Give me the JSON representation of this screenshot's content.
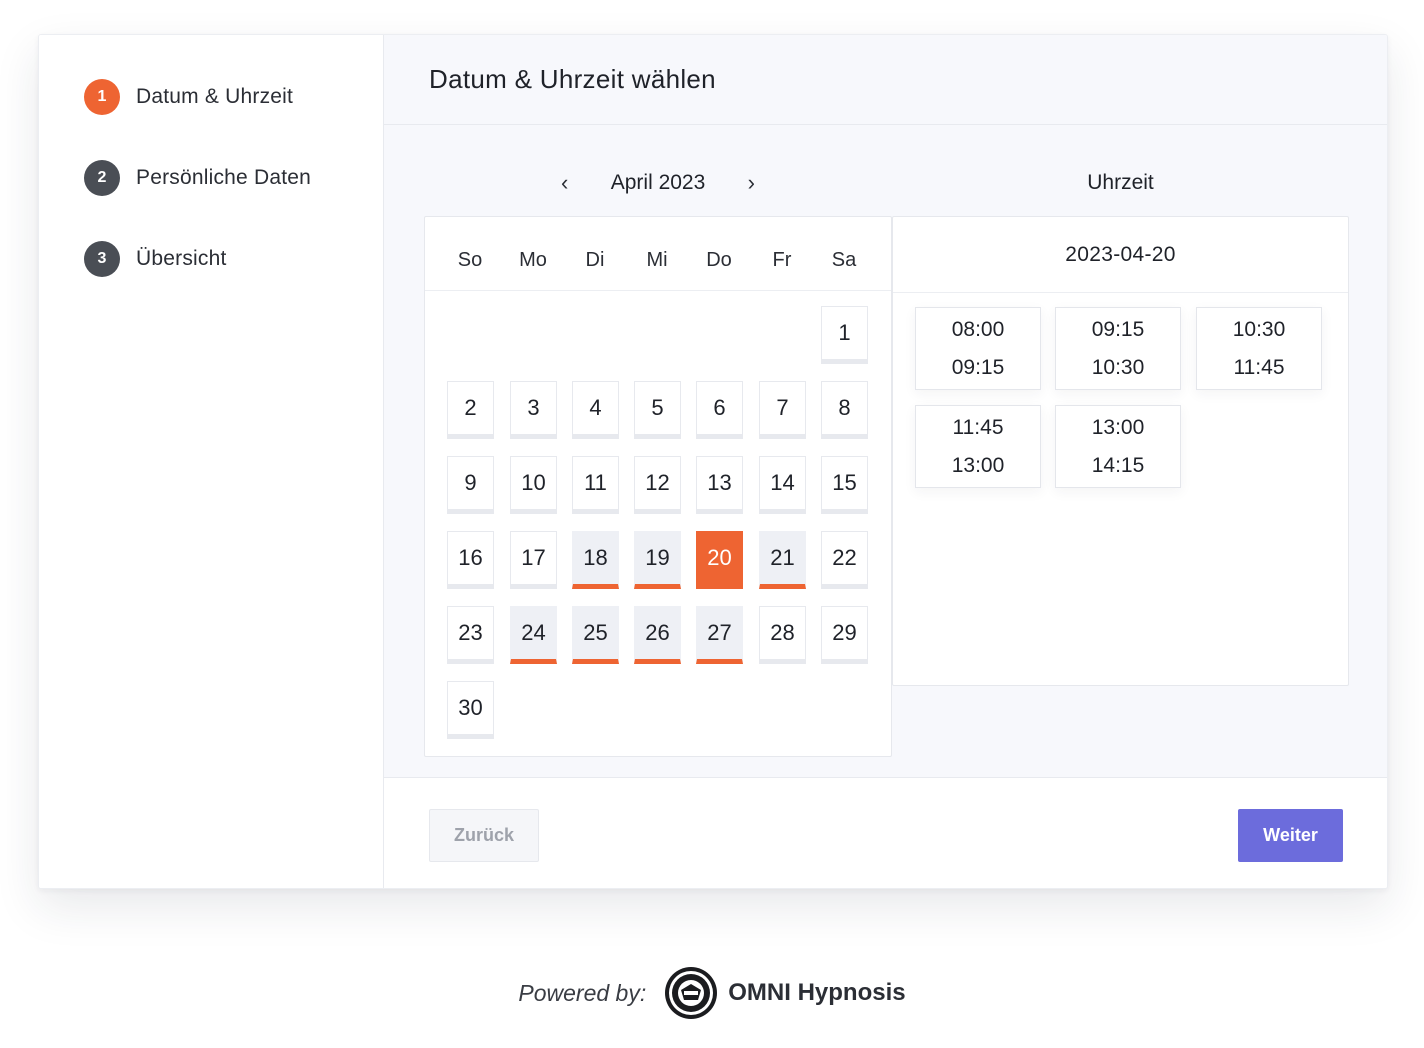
{
  "sidebar": {
    "steps": [
      {
        "number": "1",
        "label": "Datum & Uhrzeit",
        "active": true
      },
      {
        "number": "2",
        "label": "Persönliche Daten",
        "active": false
      },
      {
        "number": "3",
        "label": "Übersicht",
        "active": false
      }
    ]
  },
  "header": {
    "title": "Datum & Uhrzeit wählen"
  },
  "calendar": {
    "prev_icon": "‹",
    "next_icon": "›",
    "month_label": "April 2023",
    "weekdays": [
      "So",
      "Mo",
      "Di",
      "Mi",
      "Do",
      "Fr",
      "Sa"
    ],
    "first_weekday_index": 6,
    "days_in_month": 30,
    "available_days": [
      18,
      19,
      21,
      24,
      25,
      26,
      27
    ],
    "selected_day": 20
  },
  "times": {
    "title": "Uhrzeit",
    "selected_date": "2023-04-20",
    "slots": [
      {
        "start": "08:00",
        "end": "09:15"
      },
      {
        "start": "09:15",
        "end": "10:30"
      },
      {
        "start": "10:30",
        "end": "11:45"
      },
      {
        "start": "11:45",
        "end": "13:00"
      },
      {
        "start": "13:00",
        "end": "14:15"
      }
    ]
  },
  "footer": {
    "back_label": "Zurück",
    "next_label": "Weiter"
  },
  "powered": {
    "prefix": "Powered by:",
    "brand": "OMNI Hypnosis",
    "logo_icon": "omni-seal-logo"
  },
  "colors": {
    "accent": "#ee6432",
    "primary_button": "#6c6cdc",
    "step_inactive": "#4a4e55"
  }
}
